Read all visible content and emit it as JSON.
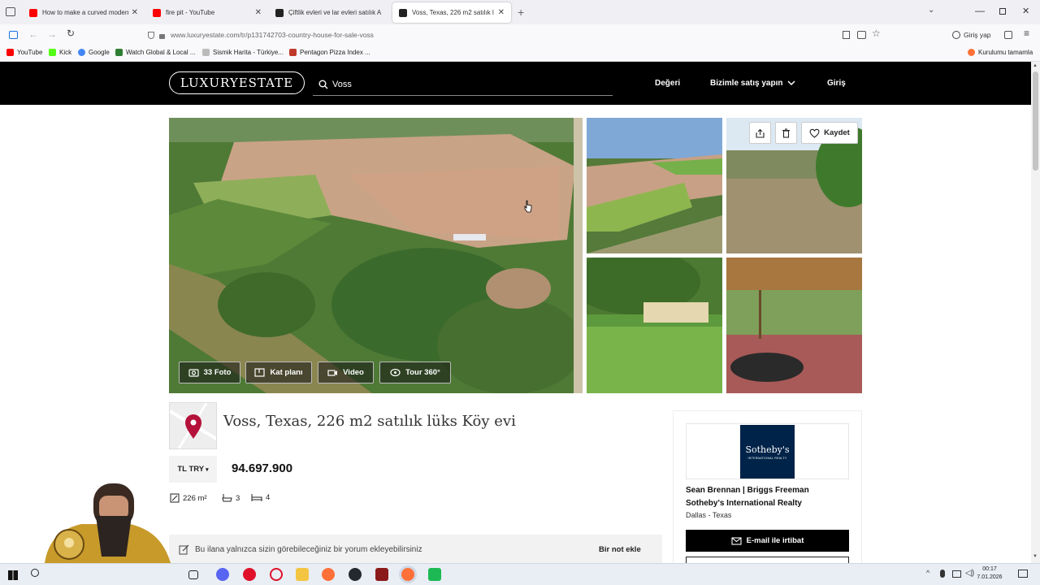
{
  "browser": {
    "tabs": [
      {
        "title": "How to make a curved modern",
        "favicon_color": "#ff0000",
        "active": false
      },
      {
        "title": "fire pit - YouTube",
        "favicon_color": "#ff0000",
        "active": false
      },
      {
        "title": "Çiftlik evleri ve lar evleri satılık A",
        "favicon_color": "#222222",
        "active": false
      },
      {
        "title": "Voss, Texas, 226 m2 satılık l",
        "favicon_color": "#222222",
        "active": true
      }
    ],
    "url": "www.luxuryestate.com/tr/p131742703-country-house-for-sale-voss",
    "profile_label": "Giriş yap",
    "bookmarks": [
      {
        "label": "YouTube",
        "color": "#ff0000"
      },
      {
        "label": "Kick",
        "color": "#53fc18"
      },
      {
        "label": "Google",
        "color": "#4285f4"
      },
      {
        "label": "Watch Global & Local ...",
        "color": "#2e7d32"
      },
      {
        "label": "Sismik Harita - Türkiye...",
        "color": "#bbbbbb"
      },
      {
        "label": "Pentagon Pizza Index ...",
        "color": "#c0392b"
      }
    ],
    "bookmarks_right": "Kurulumu tamamla"
  },
  "site": {
    "logo": "LUXURYESTATE",
    "search_value": "Voss",
    "nav": {
      "value": "Değeri",
      "sell": "Bizimle satış yapın",
      "login": "Giriş"
    }
  },
  "gallery": {
    "save_label": "Kaydet",
    "buttons": {
      "photos": "33 Foto",
      "floorplan": "Kat planı",
      "video": "Video",
      "tour": "Tour 360°"
    }
  },
  "listing": {
    "title": "Voss, Texas, 226 m2 satılık lüks Köy evi",
    "currency": "TL TRY",
    "price": "94.697.900",
    "area": "226 m²",
    "baths": "3",
    "beds": "4",
    "note_prompt": "Bu ilana yalnızca sizin görebileceğiniz bir yorum ekleyebilirsiniz",
    "note_button": "Bir not ekle"
  },
  "agent": {
    "logo_line1": "Sotheby's",
    "logo_line2": "INTERNATIONAL REALTY",
    "names": "Sean Brennan | Briggs Freeman",
    "agency": "Sotheby's International Realty",
    "location": "Dallas - Texas",
    "email_label": "E-mail ile irtibat"
  },
  "taskbar": {
    "time": "00:17",
    "date": "7.01.2026"
  }
}
